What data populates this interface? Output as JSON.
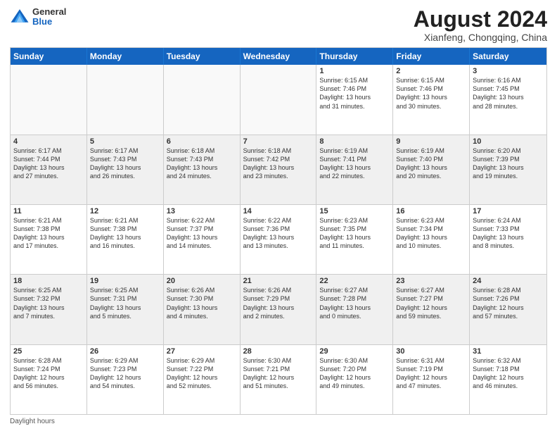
{
  "header": {
    "logo": {
      "general": "General",
      "blue": "Blue"
    },
    "title": "August 2024",
    "location": "Xianfeng, Chongqing, China"
  },
  "days": [
    "Sunday",
    "Monday",
    "Tuesday",
    "Wednesday",
    "Thursday",
    "Friday",
    "Saturday"
  ],
  "weeks": [
    [
      {
        "date": "",
        "info": "",
        "empty": true
      },
      {
        "date": "",
        "info": "",
        "empty": true
      },
      {
        "date": "",
        "info": "",
        "empty": true
      },
      {
        "date": "",
        "info": "",
        "empty": true
      },
      {
        "date": "1",
        "info": "Sunrise: 6:15 AM\nSunset: 7:46 PM\nDaylight: 13 hours\nand 31 minutes."
      },
      {
        "date": "2",
        "info": "Sunrise: 6:15 AM\nSunset: 7:46 PM\nDaylight: 13 hours\nand 30 minutes."
      },
      {
        "date": "3",
        "info": "Sunrise: 6:16 AM\nSunset: 7:45 PM\nDaylight: 13 hours\nand 28 minutes."
      }
    ],
    [
      {
        "date": "4",
        "info": "Sunrise: 6:17 AM\nSunset: 7:44 PM\nDaylight: 13 hours\nand 27 minutes."
      },
      {
        "date": "5",
        "info": "Sunrise: 6:17 AM\nSunset: 7:43 PM\nDaylight: 13 hours\nand 26 minutes."
      },
      {
        "date": "6",
        "info": "Sunrise: 6:18 AM\nSunset: 7:43 PM\nDaylight: 13 hours\nand 24 minutes."
      },
      {
        "date": "7",
        "info": "Sunrise: 6:18 AM\nSunset: 7:42 PM\nDaylight: 13 hours\nand 23 minutes."
      },
      {
        "date": "8",
        "info": "Sunrise: 6:19 AM\nSunset: 7:41 PM\nDaylight: 13 hours\nand 22 minutes."
      },
      {
        "date": "9",
        "info": "Sunrise: 6:19 AM\nSunset: 7:40 PM\nDaylight: 13 hours\nand 20 minutes."
      },
      {
        "date": "10",
        "info": "Sunrise: 6:20 AM\nSunset: 7:39 PM\nDaylight: 13 hours\nand 19 minutes."
      }
    ],
    [
      {
        "date": "11",
        "info": "Sunrise: 6:21 AM\nSunset: 7:38 PM\nDaylight: 13 hours\nand 17 minutes."
      },
      {
        "date": "12",
        "info": "Sunrise: 6:21 AM\nSunset: 7:38 PM\nDaylight: 13 hours\nand 16 minutes."
      },
      {
        "date": "13",
        "info": "Sunrise: 6:22 AM\nSunset: 7:37 PM\nDaylight: 13 hours\nand 14 minutes."
      },
      {
        "date": "14",
        "info": "Sunrise: 6:22 AM\nSunset: 7:36 PM\nDaylight: 13 hours\nand 13 minutes."
      },
      {
        "date": "15",
        "info": "Sunrise: 6:23 AM\nSunset: 7:35 PM\nDaylight: 13 hours\nand 11 minutes."
      },
      {
        "date": "16",
        "info": "Sunrise: 6:23 AM\nSunset: 7:34 PM\nDaylight: 13 hours\nand 10 minutes."
      },
      {
        "date": "17",
        "info": "Sunrise: 6:24 AM\nSunset: 7:33 PM\nDaylight: 13 hours\nand 8 minutes."
      }
    ],
    [
      {
        "date": "18",
        "info": "Sunrise: 6:25 AM\nSunset: 7:32 PM\nDaylight: 13 hours\nand 7 minutes."
      },
      {
        "date": "19",
        "info": "Sunrise: 6:25 AM\nSunset: 7:31 PM\nDaylight: 13 hours\nand 5 minutes."
      },
      {
        "date": "20",
        "info": "Sunrise: 6:26 AM\nSunset: 7:30 PM\nDaylight: 13 hours\nand 4 minutes."
      },
      {
        "date": "21",
        "info": "Sunrise: 6:26 AM\nSunset: 7:29 PM\nDaylight: 13 hours\nand 2 minutes."
      },
      {
        "date": "22",
        "info": "Sunrise: 6:27 AM\nSunset: 7:28 PM\nDaylight: 13 hours\nand 0 minutes."
      },
      {
        "date": "23",
        "info": "Sunrise: 6:27 AM\nSunset: 7:27 PM\nDaylight: 12 hours\nand 59 minutes."
      },
      {
        "date": "24",
        "info": "Sunrise: 6:28 AM\nSunset: 7:26 PM\nDaylight: 12 hours\nand 57 minutes."
      }
    ],
    [
      {
        "date": "25",
        "info": "Sunrise: 6:28 AM\nSunset: 7:24 PM\nDaylight: 12 hours\nand 56 minutes."
      },
      {
        "date": "26",
        "info": "Sunrise: 6:29 AM\nSunset: 7:23 PM\nDaylight: 12 hours\nand 54 minutes."
      },
      {
        "date": "27",
        "info": "Sunrise: 6:29 AM\nSunset: 7:22 PM\nDaylight: 12 hours\nand 52 minutes."
      },
      {
        "date": "28",
        "info": "Sunrise: 6:30 AM\nSunset: 7:21 PM\nDaylight: 12 hours\nand 51 minutes."
      },
      {
        "date": "29",
        "info": "Sunrise: 6:30 AM\nSunset: 7:20 PM\nDaylight: 12 hours\nand 49 minutes."
      },
      {
        "date": "30",
        "info": "Sunrise: 6:31 AM\nSunset: 7:19 PM\nDaylight: 12 hours\nand 47 minutes."
      },
      {
        "date": "31",
        "info": "Sunrise: 6:32 AM\nSunset: 7:18 PM\nDaylight: 12 hours\nand 46 minutes."
      }
    ]
  ],
  "footer": "Daylight hours"
}
